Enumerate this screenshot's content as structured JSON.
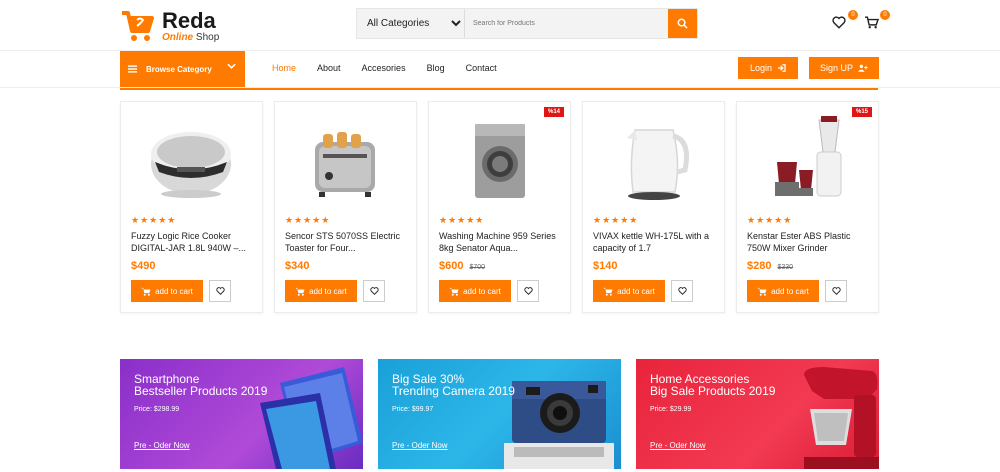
{
  "brand": {
    "name": "Reda",
    "sub_accent": "Online",
    "sub_rest": " Shop"
  },
  "search": {
    "category": "All Categories",
    "placeholder": "Search for Products"
  },
  "header": {
    "wishlist_count": "0",
    "cart_count": "0"
  },
  "nav": {
    "browse": "Browse Category",
    "items": [
      "Home",
      "About",
      "Accesories",
      "Blog",
      "Contact"
    ],
    "login": "Login",
    "signup": "Sign UP"
  },
  "products": [
    {
      "name": "Fuzzy Logic Rice Cooker DIGITAL-JAR 1.8L 940W –...",
      "price": "$490",
      "old_price": "",
      "discount": "",
      "rating": 5,
      "image": "rice-cooker"
    },
    {
      "name": "Sencor STS 5070SS Electric Toaster for Four...",
      "price": "$340",
      "old_price": "",
      "discount": "",
      "rating": 5,
      "image": "toaster"
    },
    {
      "name": "Washing Machine 959 Series 8kg Senator Aqua...",
      "price": "$600",
      "old_price": "$700",
      "discount": "%14",
      "rating": 5,
      "image": "washing-machine"
    },
    {
      "name": "VIVAX kettle WH-175L with a capacity of 1.7",
      "price": "$140",
      "old_price": "",
      "discount": "",
      "rating": 5,
      "image": "kettle"
    },
    {
      "name": "Kenstar Ester ABS Plastic 750W Mixer Grinder",
      "price": "$280",
      "old_price": "$330",
      "discount": "%15",
      "rating": 5,
      "image": "mixer-grinder"
    }
  ],
  "card_labels": {
    "add_to_cart": "add to cart",
    "stars": "★★★★★"
  },
  "banners": [
    {
      "line1": "Smartphone",
      "line2": "Bestseller Products 2019",
      "price": "Price: $298.99",
      "link": "Pre - Oder Now",
      "color": "#8a2fc9"
    },
    {
      "line1": "Big Sale 30%",
      "line2": "Trending Camera 2019",
      "price": "Price: $99.97",
      "link": "Pre - Oder Now",
      "color": "#1aa0d8"
    },
    {
      "line1": "Home Accessories",
      "line2": "Big Sale Products 2019",
      "price": "Price: $29.99",
      "link": "Pre - Oder Now",
      "color": "#e8243c"
    }
  ],
  "colors": {
    "accent": "#ff7a00",
    "discount": "#e01515"
  }
}
